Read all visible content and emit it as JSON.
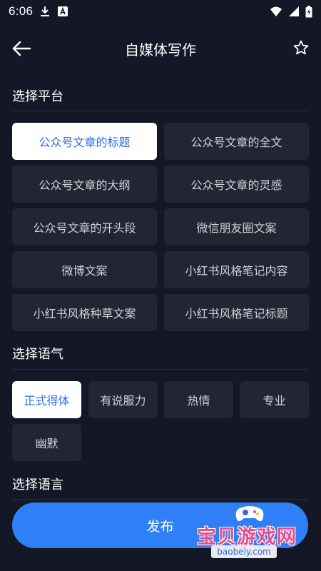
{
  "status_bar": {
    "time": "6:06"
  },
  "header": {
    "title": "自媒体写作"
  },
  "platform_section": {
    "title": "选择平台",
    "options": [
      "公众号文章的标题",
      "公众号文章的全文",
      "公众号文章的大纲",
      "公众号文章的灵感",
      "公众号文章的开头段",
      "微信朋友圈文案",
      "微博文案",
      "小红书风格笔记内容",
      "小红书风格种草文案",
      "小红书风格笔记标题"
    ],
    "selected": "公众号文章的标题"
  },
  "tone_section": {
    "title": "选择语气",
    "options": [
      "正式得体",
      "有说服力",
      "热情",
      "专业",
      "幽默"
    ],
    "selected": "正式得体"
  },
  "language_section": {
    "title": "选择语言"
  },
  "publish_button": {
    "label": "发布"
  },
  "watermark": {
    "text": "宝贝游戏网",
    "url": "baobeiy.com"
  },
  "colors": {
    "background": "#141826",
    "button": "#222633",
    "selected_button": "#ffffff",
    "selected_text": "#2a6ff0",
    "accent": "#2f80f6"
  },
  "icons": [
    "download-icon",
    "font-icon",
    "wifi-icon",
    "signal-icon",
    "battery-icon",
    "back-arrow-icon",
    "star-icon"
  ]
}
